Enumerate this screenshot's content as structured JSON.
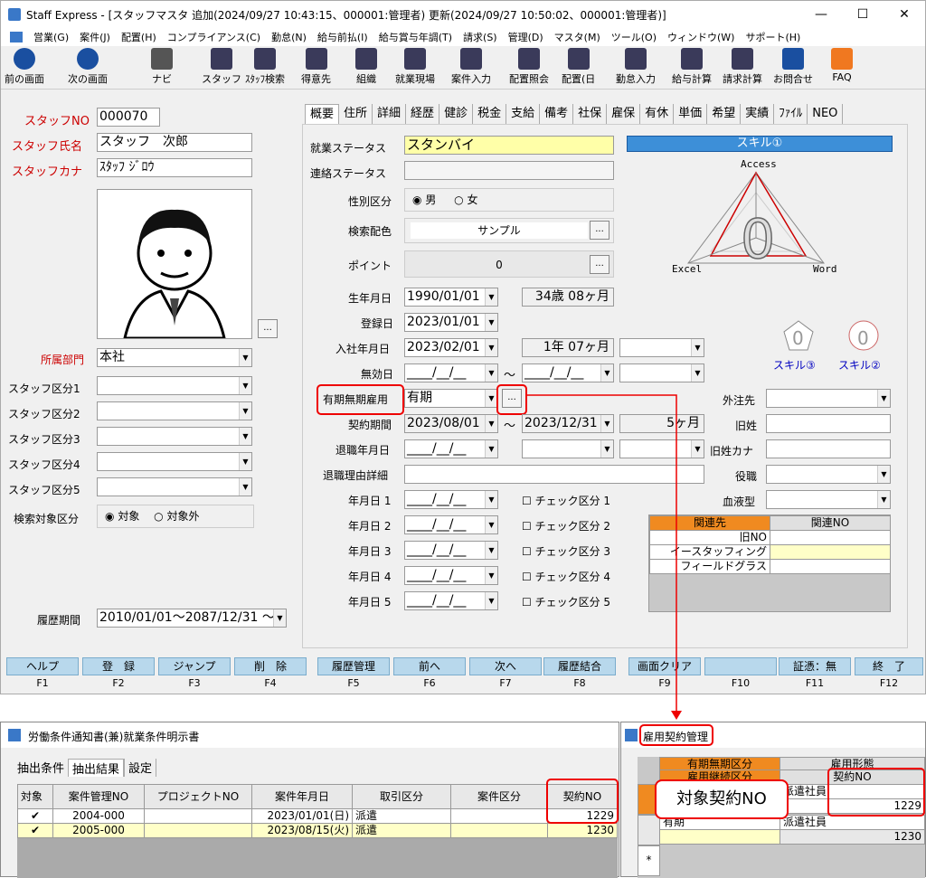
{
  "window_title": "Staff Express - [スタッフマスタ  追加(2024/09/27 10:43:15、000001:管理者)  更新(2024/09/27 10:50:02、000001:管理者)]",
  "menu": [
    "営業(G)",
    "案件(J)",
    "配置(H)",
    "コンプライアンス(C)",
    "勤怠(N)",
    "給与前払(I)",
    "給与賞与年調(T)",
    "請求(S)",
    "管理(D)",
    "マスタ(M)",
    "ツール(O)",
    "ウィンドウ(W)",
    "サポート(H)"
  ],
  "toolbar": [
    "前の画面",
    "次の画面",
    "ナビ",
    "スタッフ",
    "ｽﾀｯﾌ検索",
    "得意先",
    "組織",
    "就業現場",
    "案件入力",
    "配置照会",
    "配置(日",
    "勤怠入力",
    "給与計算",
    "請求計算",
    "お問合せ",
    "FAQ"
  ],
  "left": {
    "staff_no_label": "スタッフNO",
    "staff_no": "000070",
    "name_label": "スタッフ氏名",
    "name": "スタッフ　次郎",
    "kana_label": "スタッフカナ",
    "kana": "ｽﾀｯﾌ ｼﾞﾛｳ",
    "dept_label": "所属部門",
    "dept": "本社",
    "kubun_labels": [
      "スタッフ区分1",
      "スタッフ区分2",
      "スタッフ区分3",
      "スタッフ区分4",
      "スタッフ区分5"
    ],
    "search_label": "検索対象区分",
    "search_opt1": "対象",
    "search_opt2": "対象外",
    "period_label": "履歴期間",
    "period": "2010/01/01〜2087/12/31 ～"
  },
  "tabs": [
    "概要",
    "住所",
    "詳細",
    "経歴",
    "健診",
    "税金",
    "支給",
    "備考",
    "社保",
    "雇保",
    "有休",
    "単価",
    "希望",
    "実績",
    "ﾌｧｲﾙ",
    "NEO"
  ],
  "main": {
    "work_status_label": "就業ステータス",
    "work_status": "スタンバイ",
    "contact_status_label": "連絡ステータス",
    "gender_label": "性別区分",
    "male": "男",
    "female": "女",
    "color_label": "検索配色",
    "color": "サンプル",
    "point_label": "ポイント",
    "point": "0",
    "birth_label": "生年月日",
    "birth": "1990/01/01",
    "age": "34歳 08ヶ月",
    "reg_label": "登録日",
    "reg": "2023/01/01",
    "join_label": "入社年月日",
    "join": "2023/02/01",
    "tenure": "1年 07ヶ月",
    "invalid_label": "無効日",
    "blank_date": "____/__/__",
    "term_label": "有期無期雇用",
    "term": "有期",
    "contract_label": "契約期間",
    "contract_from": "2023/08/01",
    "contract_to": "2023/12/31",
    "contract_months": "5ヶ月",
    "retire_label": "退職年月日",
    "retire_reason_label": "退職理由詳細",
    "date_labels": [
      "年月日 1",
      "年月日 2",
      "年月日 3",
      "年月日 4",
      "年月日 5"
    ],
    "check_labels": [
      "チェック区分 1",
      "チェック区分 2",
      "チェック区分 3",
      "チェック区分 4",
      "チェック区分 5"
    ],
    "tilde": "〜",
    "ellipsis": "...",
    "outside_label": "外注先",
    "old_name_label": "旧姓",
    "old_kana_label": "旧姓カナ",
    "position_label": "役職",
    "blood_label": "血液型",
    "skill_title": "スキル①",
    "skill_axes": [
      "Access",
      "Excel",
      "Word"
    ],
    "skill_big": "0",
    "skill3": "スキル③",
    "skill2": "スキル②",
    "rel_headers": [
      "関連先",
      "関連NO"
    ],
    "rel_rows": [
      "旧NO",
      "イースタッフィング",
      "フィールドグラス"
    ]
  },
  "fkeys": [
    [
      "ヘルプ",
      "F1"
    ],
    [
      "登　録",
      "F2"
    ],
    [
      "ジャンプ",
      "F3"
    ],
    [
      "削　除",
      "F4"
    ],
    [
      "履歴管理",
      "F5"
    ],
    [
      "前へ",
      "F6"
    ],
    [
      "次へ",
      "F7"
    ],
    [
      "履歴結合",
      "F8"
    ],
    [
      "画面クリア",
      "F9"
    ],
    [
      "",
      "F10"
    ],
    [
      "証憑：無",
      "F11"
    ],
    [
      "終　了",
      "F12"
    ]
  ],
  "w2": {
    "title": "労働条件通知書(兼)就業条件明示書",
    "tabs": [
      "抽出条件",
      "抽出結果",
      "設定"
    ],
    "headers": [
      "対象",
      "案件管理NO",
      "プロジェクトNO",
      "案件年月日",
      "取引区分",
      "案件区分",
      "契約NO"
    ],
    "rows": [
      [
        "✔",
        "2004-000",
        "",
        "2023/01/01(日)",
        "派遣",
        "",
        "1229"
      ],
      [
        "✔",
        "2005-000",
        "",
        "2023/08/15(火)",
        "派遣",
        "",
        "1230"
      ]
    ]
  },
  "w3": {
    "title": "雇用契約管理",
    "headers": [
      "有期無期区分",
      "雇用形態"
    ],
    "headers2": [
      "雇用継続区分",
      "契約NO"
    ],
    "row1": [
      "",
      "派遣社員",
      "1229"
    ],
    "row2": [
      "有期",
      "派遣社員",
      "1230"
    ],
    "star": "*"
  },
  "callout": "対象契約NO"
}
